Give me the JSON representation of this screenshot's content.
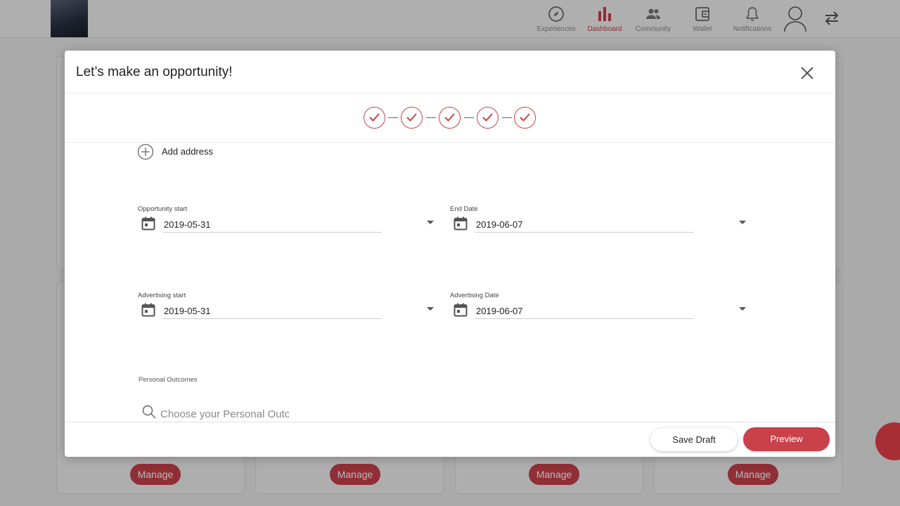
{
  "nav": {
    "items": [
      {
        "label": "Experiences",
        "icon": "compass-icon",
        "active": false
      },
      {
        "label": "Dashboard",
        "icon": "bar-chart-icon",
        "active": true
      },
      {
        "label": "Community",
        "icon": "people-icon",
        "active": false
      },
      {
        "label": "Wallet",
        "icon": "wallet-icon",
        "active": false
      },
      {
        "label": "Notifications",
        "icon": "bell-icon",
        "active": false
      }
    ],
    "accent_color": "#c8414b"
  },
  "background": {
    "manage_label": "Manage"
  },
  "modal": {
    "title": "Let’s make an opportunity!",
    "steps_completed": 5,
    "add_address_label": "Add address",
    "opportunity_start": {
      "label": "Opportunity start",
      "value": "2019-05-31"
    },
    "end_date": {
      "label": "End Date",
      "value": "2019-06-07"
    },
    "advertising_start": {
      "label": "Advertising start",
      "value": "2019-05-31"
    },
    "advertising_date": {
      "label": "Advertising Date",
      "value": "2019-06-07"
    },
    "personal_outcomes": {
      "label": "Personal Outcomes",
      "placeholder": "Choose your Personal Outcomes"
    },
    "save_draft_label": "Save Draft",
    "preview_label": "Preview"
  }
}
